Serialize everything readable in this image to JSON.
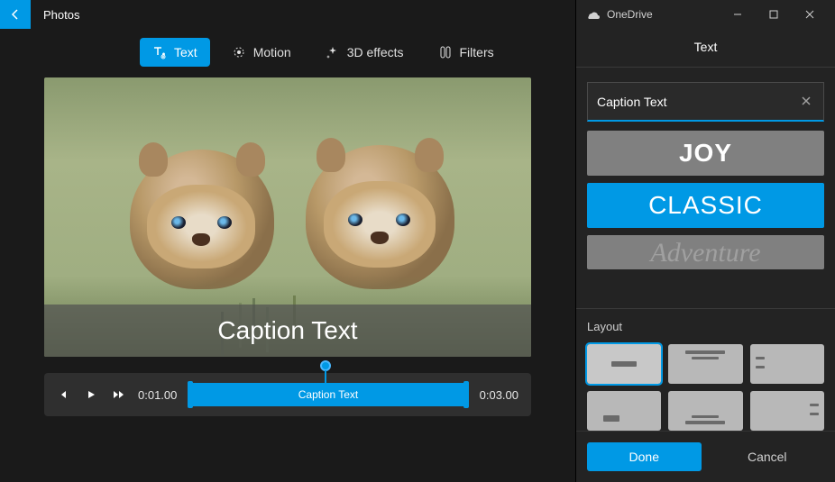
{
  "app_title": "Photos",
  "onedrive_label": "OneDrive",
  "toolbar": {
    "text": "Text",
    "motion": "Motion",
    "effects": "3D effects",
    "filters": "Filters"
  },
  "preview": {
    "caption": "Caption Text"
  },
  "timeline": {
    "start": "0:01.00",
    "end": "0:03.00",
    "clip_label": "Caption Text"
  },
  "sidebar": {
    "title": "Text",
    "input_value": "Caption Text",
    "styles": {
      "joy": "JOY",
      "classic": "CLASSIC",
      "adventure": "Adventure"
    },
    "layout_label": "Layout",
    "done": "Done",
    "cancel": "Cancel"
  }
}
